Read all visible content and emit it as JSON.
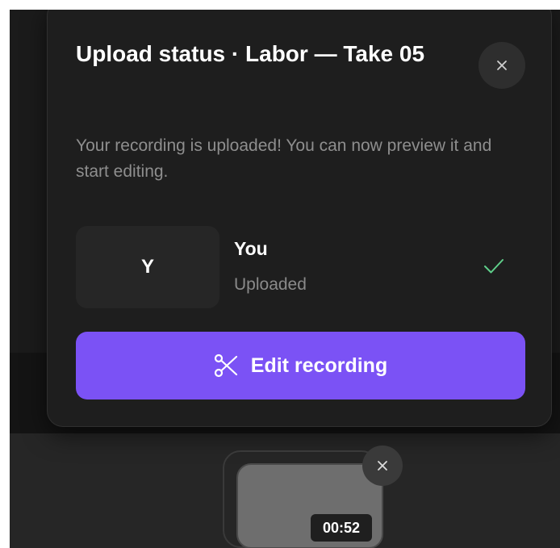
{
  "dialog": {
    "title": "Upload status · Labor — Take 05",
    "message": "Your recording is uploaded! You can now preview it and start editing.",
    "close_icon": "close-icon"
  },
  "participant": {
    "initial": "Y",
    "name": "You",
    "status": "Uploaded",
    "status_icon": "check-icon",
    "status_color": "#5fcf8a"
  },
  "edit_button": {
    "label": "Edit recording",
    "icon": "scissors-icon",
    "color": "#7b52f5"
  },
  "recording_thumbnail": {
    "duration": "00:52",
    "remove_icon": "close-icon"
  }
}
